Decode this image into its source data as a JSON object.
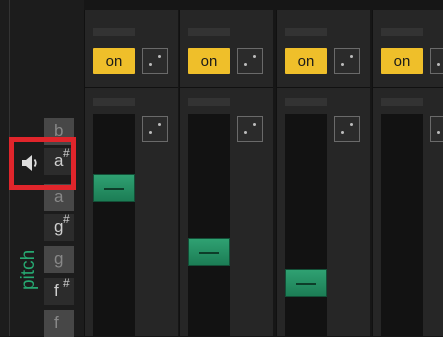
{
  "columns": [
    {
      "on_label": "on",
      "fader_level": 0.7
    },
    {
      "on_label": "on",
      "fader_level": 0.32
    },
    {
      "on_label": "on",
      "fader_level": 0.1
    },
    {
      "on_label": "on",
      "fader_level": null
    }
  ],
  "keys": [
    {
      "letter": "b",
      "sharp": ""
    },
    {
      "letter": "a",
      "sharp": "#"
    },
    {
      "letter": "a",
      "sharp": ""
    },
    {
      "letter": "g",
      "sharp": "#"
    },
    {
      "letter": "g",
      "sharp": ""
    },
    {
      "letter": "f",
      "sharp": "#"
    },
    {
      "letter": "f",
      "sharp": ""
    }
  ],
  "pitch_label": "pitch",
  "colors": {
    "on_button": "#efbf2a",
    "fader": "#2fa172",
    "pitch_label": "#26a871",
    "highlight": "#e0252b"
  },
  "icons": {
    "speaker": "speaker-icon",
    "random": "dice-icon"
  }
}
